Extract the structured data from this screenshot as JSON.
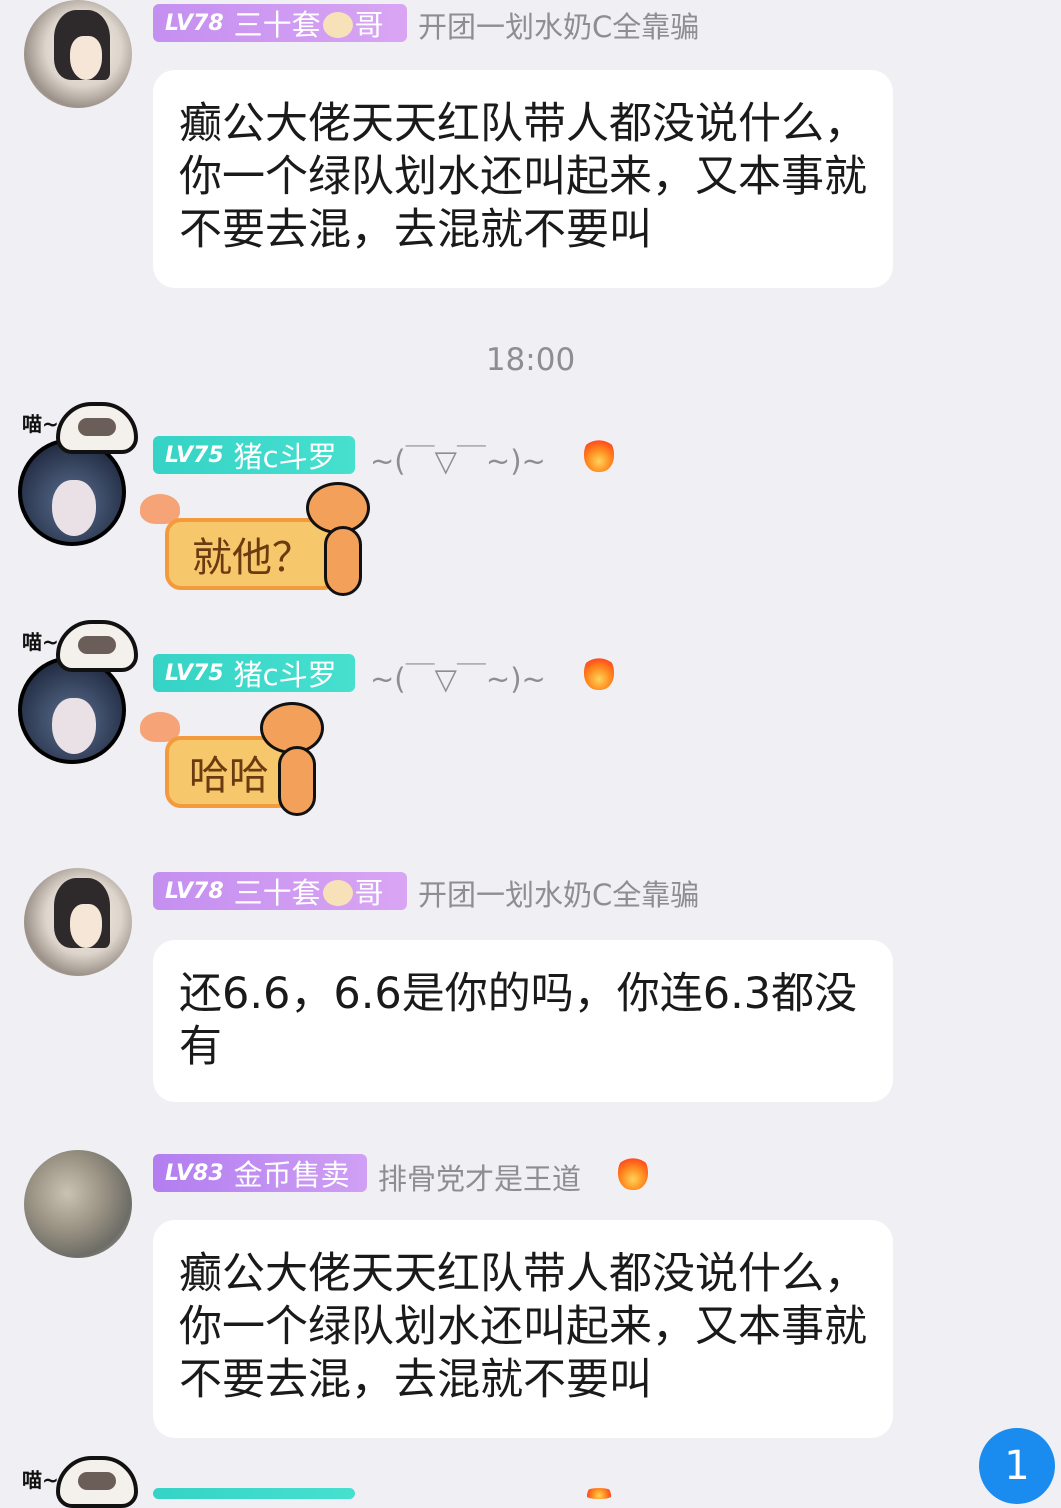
{
  "messages": [
    {
      "level": "LV78",
      "name_before": "三十套",
      "name_after": "哥",
      "signature": "开团一划水奶C全靠骗",
      "text": "癫公大佬天天红队带人都没说什么，你一个绿队划水还叫起来，又本事就不要去混，去混就不要叫"
    },
    {
      "level": "LV75",
      "name": "猪c斗罗",
      "signature": "~(￣▽￣~)~",
      "meow": "喵~",
      "sticker_text": "就他？"
    },
    {
      "level": "LV75",
      "name": "猪c斗罗",
      "signature": "~(￣▽￣~)~",
      "meow": "喵~",
      "sticker_text": "哈哈"
    },
    {
      "level": "LV78",
      "name_before": "三十套",
      "name_after": "哥",
      "signature": "开团一划水奶C全靠骗",
      "text": "还6.6，6.6是你的吗，你连6.3都没有"
    },
    {
      "level": "LV83",
      "name": "金币售卖",
      "signature": "排骨党才是王道",
      "text": "癫公大佬天天红队带人都没说什么，你一个绿队划水还叫起来，又本事就不要去混，去混就不要叫"
    }
  ],
  "timestamp": "18:00",
  "partial_bottom": {
    "meow": "喵~"
  },
  "unread_count": "1",
  "icons": {
    "fire": "fire-icon",
    "cow": "cow-emoji-icon"
  },
  "colors": {
    "background": "#efeff4",
    "badge_purple": "#c48ff0",
    "badge_teal": "#35d3c6",
    "unread": "#1a8cf0"
  }
}
